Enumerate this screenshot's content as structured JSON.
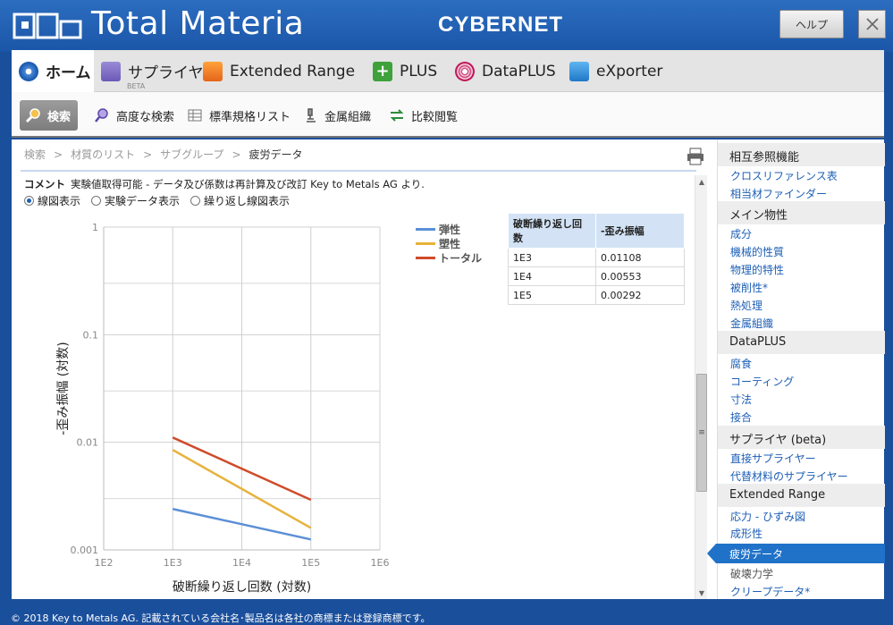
{
  "header": {
    "app_title": "Total Materia",
    "brand": "CYBERNET",
    "help_label": "ヘルプ",
    "close_label": "✕"
  },
  "tabs": [
    {
      "label": "ホーム",
      "icon": "home-icon",
      "active": true
    },
    {
      "label": "サプライヤ",
      "icon": "supplier-icon",
      "badge": "BETA"
    },
    {
      "label": "Extended Range",
      "icon": "extended-range-icon"
    },
    {
      "label": "PLUS",
      "icon": "plus-icon"
    },
    {
      "label": "DataPLUS",
      "icon": "dataplus-icon"
    },
    {
      "label": "eXporter",
      "icon": "exporter-icon"
    }
  ],
  "subtabs": [
    {
      "label": "検索",
      "icon": "search-icon",
      "active": true
    },
    {
      "label": "高度な検索",
      "icon": "advanced-search-icon"
    },
    {
      "label": "標準規格リスト",
      "icon": "standards-list-icon"
    },
    {
      "label": "金属組織",
      "icon": "microstructure-icon"
    },
    {
      "label": "比較閲覧",
      "icon": "compare-icon"
    }
  ],
  "breadcrumb": {
    "items": [
      "検索",
      "材質のリスト",
      "サブグループ"
    ],
    "current": "疲労データ",
    "sep": ">"
  },
  "comment": {
    "label": "コメント",
    "text": "実験値取得可能 - データ及び係数は再計算及び改訂 Key to Metals AG より."
  },
  "view_options": [
    {
      "label": "線図表示",
      "selected": true
    },
    {
      "label": "実験データ表示",
      "selected": false
    },
    {
      "label": "繰り返し線図表示",
      "selected": false
    }
  ],
  "table": {
    "headers": [
      "破断繰り返し回数",
      "-歪み振幅"
    ],
    "rows": [
      [
        "1E3",
        "0.01108"
      ],
      [
        "1E4",
        "0.00553"
      ],
      [
        "1E5",
        "0.00292"
      ]
    ]
  },
  "chart_data": {
    "type": "line",
    "xlabel": "破断繰り返し回数 (対数)",
    "ylabel": "-歪み振幅 (対数)",
    "x_scale": "log",
    "y_scale": "log",
    "xlim": [
      100,
      1000000
    ],
    "ylim": [
      0.001,
      1
    ],
    "x_ticks": [
      "1E2",
      "1E3",
      "1E4",
      "1E5",
      "1E6"
    ],
    "y_ticks": [
      "1",
      "0.1",
      "0.01",
      "0.001"
    ],
    "grid": true,
    "legend_position": "top-right",
    "series": [
      {
        "name": "弾性",
        "color": "#5b8fd6",
        "x": [
          1000,
          100000
        ],
        "y": [
          0.0024,
          0.00125
        ]
      },
      {
        "name": "塑性",
        "color": "#e7b23c",
        "x": [
          1000,
          100000
        ],
        "y": [
          0.0085,
          0.0016
        ]
      },
      {
        "name": "トータル",
        "color": "#cf4b2b",
        "x": [
          1000,
          100000
        ],
        "y": [
          0.01108,
          0.00292
        ]
      }
    ]
  },
  "sidebar": {
    "sections": [
      {
        "title": "相互参照機能",
        "links": [
          "クロスリファレンス表",
          "相当材ファインダー"
        ]
      },
      {
        "title": "メイン物性",
        "links": [
          "成分",
          "機械的性質",
          "物理的特性",
          "被削性*",
          "熱処理",
          "金属組織"
        ]
      },
      {
        "title": "DataPLUS",
        "links": [
          "腐食",
          "コーティング",
          "寸法",
          "接合"
        ]
      },
      {
        "title": "サプライヤ (beta)",
        "links": [
          "直接サプライヤー",
          "代替材料のサプライヤー"
        ]
      },
      {
        "title": "Extended Range",
        "links": [
          "応力 - ひずみ図",
          "成形性",
          "疲労データ",
          "破壊力学",
          "クリープデータ*"
        ]
      }
    ],
    "active_link": "疲労データ"
  },
  "footer": {
    "text": "© 2018 Key to Metals AG. 記載されている会社名･製品名は各社の商標または登録商標です。"
  }
}
